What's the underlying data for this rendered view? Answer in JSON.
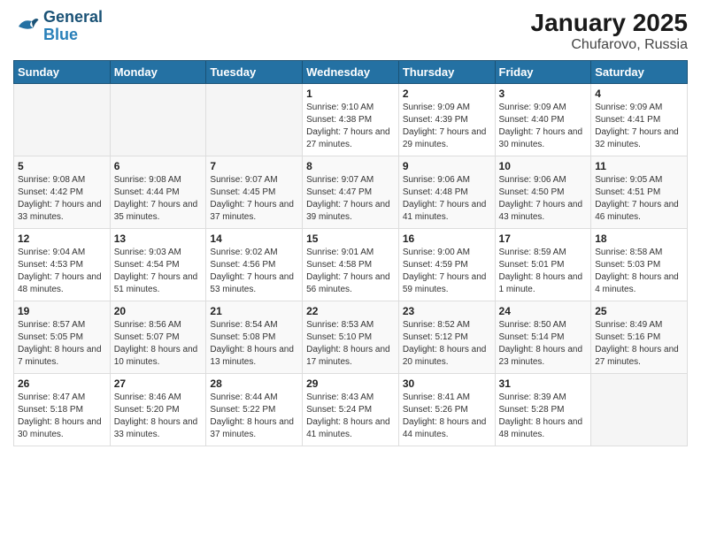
{
  "logo": {
    "line1": "General",
    "line2": "Blue"
  },
  "title": "January 2025",
  "subtitle": "Chufarovo, Russia",
  "days_of_week": [
    "Sunday",
    "Monday",
    "Tuesday",
    "Wednesday",
    "Thursday",
    "Friday",
    "Saturday"
  ],
  "weeks": [
    [
      {
        "day": "",
        "sunrise": "",
        "sunset": "",
        "daylight": ""
      },
      {
        "day": "",
        "sunrise": "",
        "sunset": "",
        "daylight": ""
      },
      {
        "day": "",
        "sunrise": "",
        "sunset": "",
        "daylight": ""
      },
      {
        "day": "1",
        "sunrise": "Sunrise: 9:10 AM",
        "sunset": "Sunset: 4:38 PM",
        "daylight": "Daylight: 7 hours and 27 minutes."
      },
      {
        "day": "2",
        "sunrise": "Sunrise: 9:09 AM",
        "sunset": "Sunset: 4:39 PM",
        "daylight": "Daylight: 7 hours and 29 minutes."
      },
      {
        "day": "3",
        "sunrise": "Sunrise: 9:09 AM",
        "sunset": "Sunset: 4:40 PM",
        "daylight": "Daylight: 7 hours and 30 minutes."
      },
      {
        "day": "4",
        "sunrise": "Sunrise: 9:09 AM",
        "sunset": "Sunset: 4:41 PM",
        "daylight": "Daylight: 7 hours and 32 minutes."
      }
    ],
    [
      {
        "day": "5",
        "sunrise": "Sunrise: 9:08 AM",
        "sunset": "Sunset: 4:42 PM",
        "daylight": "Daylight: 7 hours and 33 minutes."
      },
      {
        "day": "6",
        "sunrise": "Sunrise: 9:08 AM",
        "sunset": "Sunset: 4:44 PM",
        "daylight": "Daylight: 7 hours and 35 minutes."
      },
      {
        "day": "7",
        "sunrise": "Sunrise: 9:07 AM",
        "sunset": "Sunset: 4:45 PM",
        "daylight": "Daylight: 7 hours and 37 minutes."
      },
      {
        "day": "8",
        "sunrise": "Sunrise: 9:07 AM",
        "sunset": "Sunset: 4:47 PM",
        "daylight": "Daylight: 7 hours and 39 minutes."
      },
      {
        "day": "9",
        "sunrise": "Sunrise: 9:06 AM",
        "sunset": "Sunset: 4:48 PM",
        "daylight": "Daylight: 7 hours and 41 minutes."
      },
      {
        "day": "10",
        "sunrise": "Sunrise: 9:06 AM",
        "sunset": "Sunset: 4:50 PM",
        "daylight": "Daylight: 7 hours and 43 minutes."
      },
      {
        "day": "11",
        "sunrise": "Sunrise: 9:05 AM",
        "sunset": "Sunset: 4:51 PM",
        "daylight": "Daylight: 7 hours and 46 minutes."
      }
    ],
    [
      {
        "day": "12",
        "sunrise": "Sunrise: 9:04 AM",
        "sunset": "Sunset: 4:53 PM",
        "daylight": "Daylight: 7 hours and 48 minutes."
      },
      {
        "day": "13",
        "sunrise": "Sunrise: 9:03 AM",
        "sunset": "Sunset: 4:54 PM",
        "daylight": "Daylight: 7 hours and 51 minutes."
      },
      {
        "day": "14",
        "sunrise": "Sunrise: 9:02 AM",
        "sunset": "Sunset: 4:56 PM",
        "daylight": "Daylight: 7 hours and 53 minutes."
      },
      {
        "day": "15",
        "sunrise": "Sunrise: 9:01 AM",
        "sunset": "Sunset: 4:58 PM",
        "daylight": "Daylight: 7 hours and 56 minutes."
      },
      {
        "day": "16",
        "sunrise": "Sunrise: 9:00 AM",
        "sunset": "Sunset: 4:59 PM",
        "daylight": "Daylight: 7 hours and 59 minutes."
      },
      {
        "day": "17",
        "sunrise": "Sunrise: 8:59 AM",
        "sunset": "Sunset: 5:01 PM",
        "daylight": "Daylight: 8 hours and 1 minute."
      },
      {
        "day": "18",
        "sunrise": "Sunrise: 8:58 AM",
        "sunset": "Sunset: 5:03 PM",
        "daylight": "Daylight: 8 hours and 4 minutes."
      }
    ],
    [
      {
        "day": "19",
        "sunrise": "Sunrise: 8:57 AM",
        "sunset": "Sunset: 5:05 PM",
        "daylight": "Daylight: 8 hours and 7 minutes."
      },
      {
        "day": "20",
        "sunrise": "Sunrise: 8:56 AM",
        "sunset": "Sunset: 5:07 PM",
        "daylight": "Daylight: 8 hours and 10 minutes."
      },
      {
        "day": "21",
        "sunrise": "Sunrise: 8:54 AM",
        "sunset": "Sunset: 5:08 PM",
        "daylight": "Daylight: 8 hours and 13 minutes."
      },
      {
        "day": "22",
        "sunrise": "Sunrise: 8:53 AM",
        "sunset": "Sunset: 5:10 PM",
        "daylight": "Daylight: 8 hours and 17 minutes."
      },
      {
        "day": "23",
        "sunrise": "Sunrise: 8:52 AM",
        "sunset": "Sunset: 5:12 PM",
        "daylight": "Daylight: 8 hours and 20 minutes."
      },
      {
        "day": "24",
        "sunrise": "Sunrise: 8:50 AM",
        "sunset": "Sunset: 5:14 PM",
        "daylight": "Daylight: 8 hours and 23 minutes."
      },
      {
        "day": "25",
        "sunrise": "Sunrise: 8:49 AM",
        "sunset": "Sunset: 5:16 PM",
        "daylight": "Daylight: 8 hours and 27 minutes."
      }
    ],
    [
      {
        "day": "26",
        "sunrise": "Sunrise: 8:47 AM",
        "sunset": "Sunset: 5:18 PM",
        "daylight": "Daylight: 8 hours and 30 minutes."
      },
      {
        "day": "27",
        "sunrise": "Sunrise: 8:46 AM",
        "sunset": "Sunset: 5:20 PM",
        "daylight": "Daylight: 8 hours and 33 minutes."
      },
      {
        "day": "28",
        "sunrise": "Sunrise: 8:44 AM",
        "sunset": "Sunset: 5:22 PM",
        "daylight": "Daylight: 8 hours and 37 minutes."
      },
      {
        "day": "29",
        "sunrise": "Sunrise: 8:43 AM",
        "sunset": "Sunset: 5:24 PM",
        "daylight": "Daylight: 8 hours and 41 minutes."
      },
      {
        "day": "30",
        "sunrise": "Sunrise: 8:41 AM",
        "sunset": "Sunset: 5:26 PM",
        "daylight": "Daylight: 8 hours and 44 minutes."
      },
      {
        "day": "31",
        "sunrise": "Sunrise: 8:39 AM",
        "sunset": "Sunset: 5:28 PM",
        "daylight": "Daylight: 8 hours and 48 minutes."
      },
      {
        "day": "",
        "sunrise": "",
        "sunset": "",
        "daylight": ""
      }
    ]
  ]
}
